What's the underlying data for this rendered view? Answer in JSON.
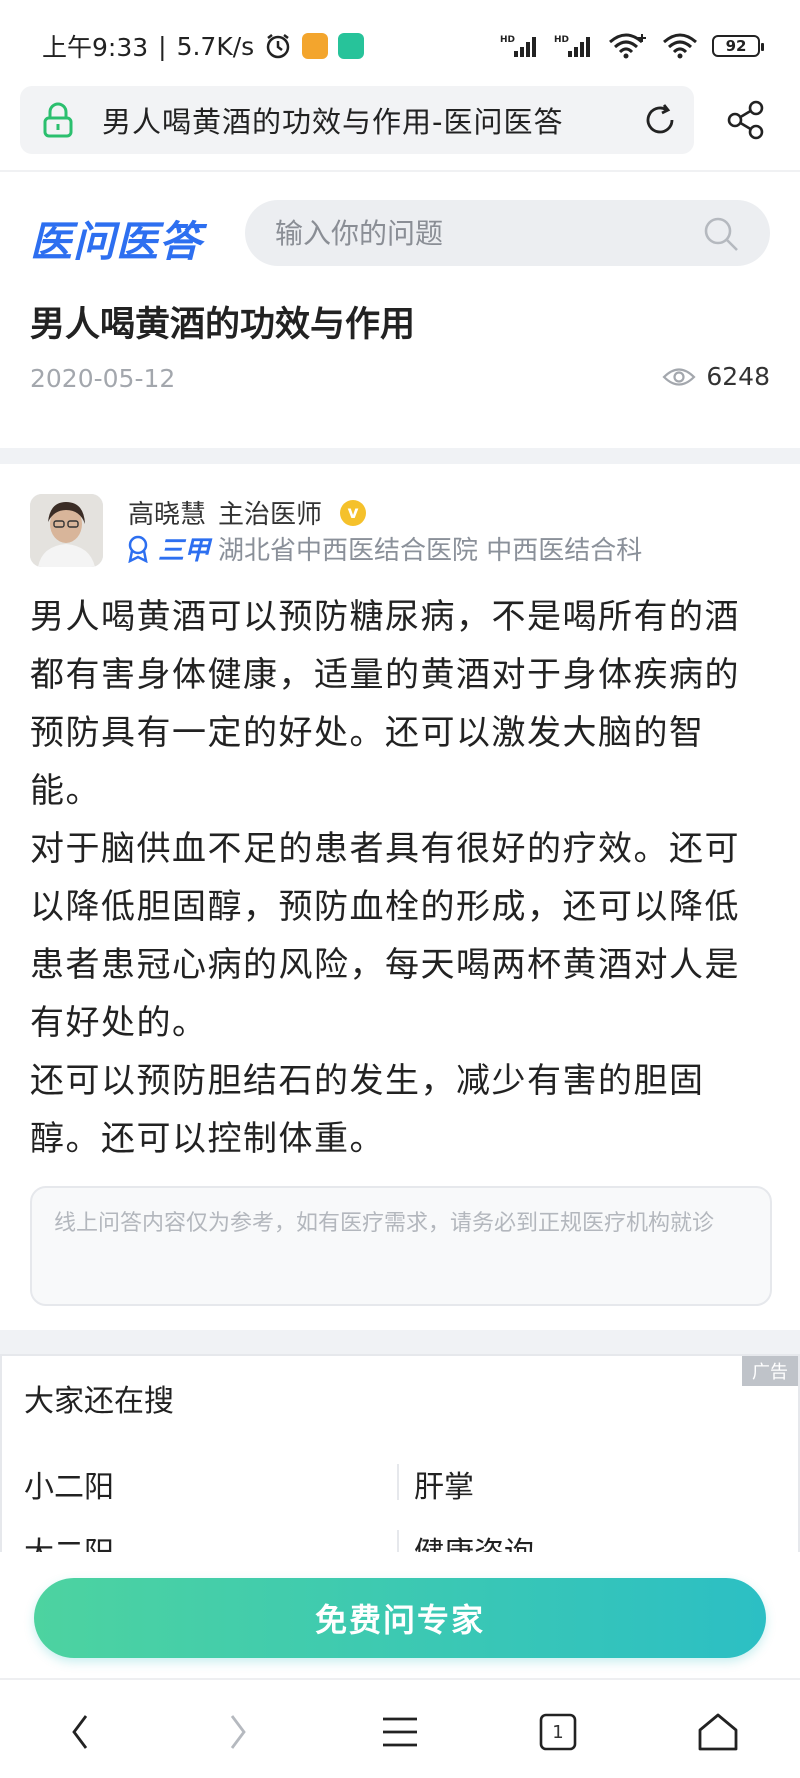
{
  "status_bar": {
    "time": "上午9:33",
    "speed": "5.7K/s",
    "battery": "92"
  },
  "browser": {
    "url_title": "男人喝黄酒的功效与作用-医问医答",
    "tab_count": "1"
  },
  "site": {
    "logo": "医问医答",
    "search_placeholder": "输入你的问题"
  },
  "article": {
    "title": "男人喝黄酒的功效与作用",
    "date": "2020-05-12",
    "views": "6248"
  },
  "doctor": {
    "name": "高晓慧",
    "title": "主治医师",
    "badge": "v",
    "grade": "三甲",
    "hospital": "湖北省中西医结合医院 中西医结合科"
  },
  "answer": {
    "paragraphs": [
      "男人喝黄酒可以预防糖尿病，不是喝所有的酒都有害身体健康，适量的黄酒对于身体疾病的预防具有一定的好处。还可以激发大脑的智能。",
      "对于脑供血不足的患者具有很好的疗效。还可以降低胆固醇，预防血栓的形成，还可以降低患者患冠心病的风险，每天喝两杯黄酒对人是有好处的。",
      "还可以预防胆结石的发生，减少有害的胆固醇。还可以控制体重。"
    ],
    "disclaimer": "线上问答内容仅为参考，如有医疗需求，请务必到正规医疗机构就诊"
  },
  "also_search": {
    "title": "大家还在搜",
    "ad_label": "广告",
    "items": [
      "小二阳",
      "肝掌",
      "大二阳",
      "健康咨询"
    ]
  },
  "cta": {
    "label": "免费问专家"
  },
  "colors": {
    "brand": "#2d6ff0",
    "cta_start": "#4dd3a0",
    "cta_end": "#2cbfc4",
    "verified": "#f5c12b"
  }
}
